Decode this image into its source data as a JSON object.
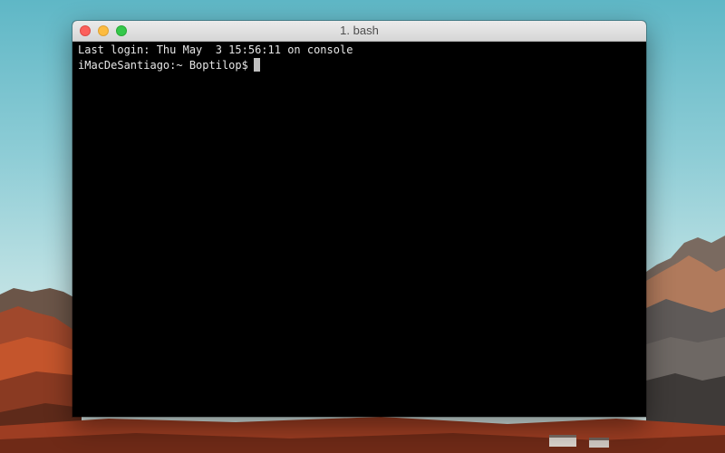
{
  "window": {
    "title": "1. bash"
  },
  "terminal": {
    "lines": [
      "Last login: Thu May  3 15:56:11 on console"
    ],
    "prompt": "iMacDeSantiago:~ Boptilop$"
  },
  "colors": {
    "terminal_background": "#000000",
    "terminal_text": "#e6e6e6",
    "cursor": "#bfbfbf",
    "close": "#fc605c",
    "minimize": "#fdbc40",
    "zoom": "#34c84a"
  },
  "icons": {
    "close": "close-icon",
    "minimize": "minimize-icon",
    "zoom": "zoom-icon"
  }
}
